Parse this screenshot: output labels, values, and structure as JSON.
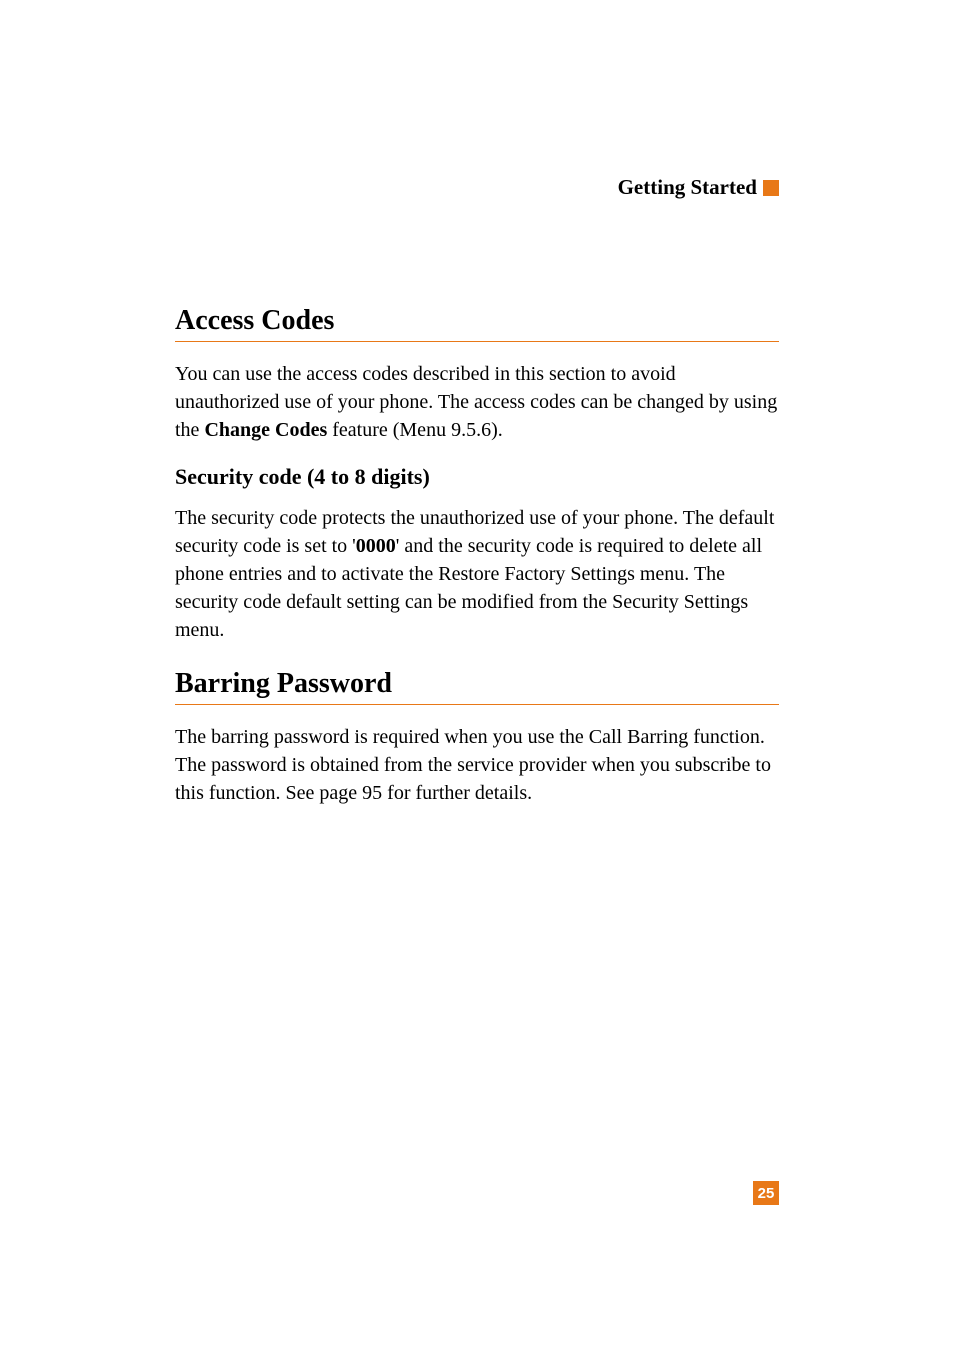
{
  "header": {
    "label": "Getting Started"
  },
  "section1": {
    "title": "Access Codes",
    "intro_pre": "You can use the access codes described in this section to avoid unauthorized use of your phone. The access codes can be changed by using the ",
    "intro_bold": "Change Codes",
    "intro_post": " feature (Menu 9.5.6).",
    "sub1_title": "Security code (4 to 8 digits)",
    "sub1_text_pre": "The security code protects the unauthorized use of your phone. The default security code is set to '",
    "sub1_text_bold": "0000",
    "sub1_text_post": "' and the security code is required to delete all phone entries and to activate the Restore Factory Settings menu. The security code default setting can be modified from the Security Settings menu."
  },
  "section2": {
    "title": "Barring Password",
    "text": "The barring password is required when you use the Call Barring function. The password is obtained from the service provider when you subscribe to this function. See page 95 for further details."
  },
  "page_number": "25"
}
